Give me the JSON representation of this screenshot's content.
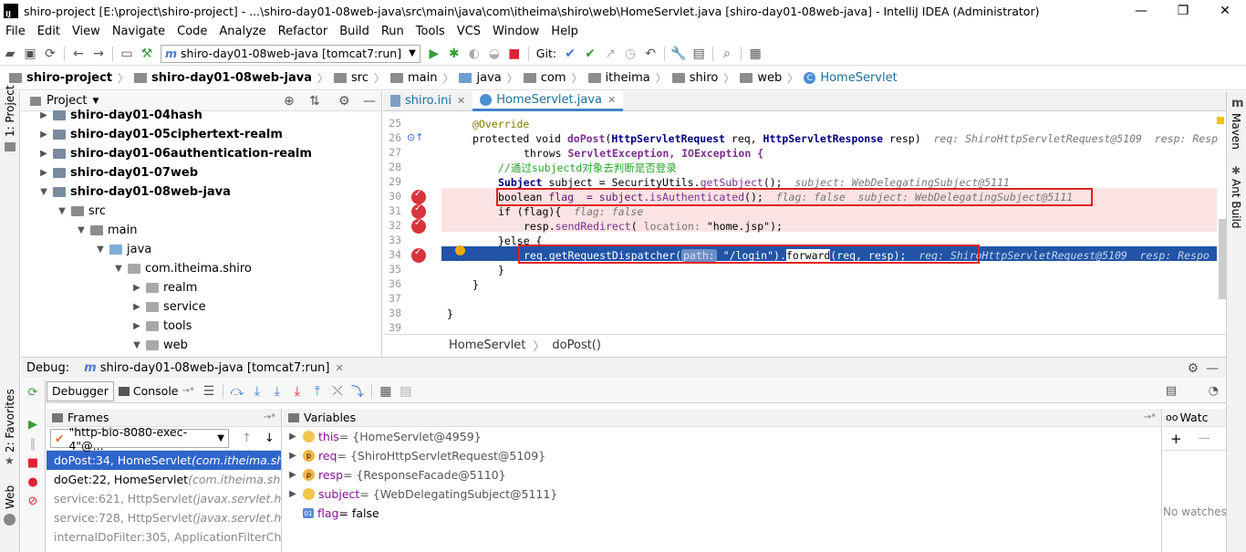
{
  "window": {
    "title": "shiro-project [E:\\project\\shiro-project] - ...\\shiro-day01-08web-java\\src\\main\\java\\com\\itheima\\shiro\\web\\HomeServlet.java [shiro-day01-08web-java] - IntelliJ IDEA (Administrator)",
    "logo": "IJ",
    "minimize": "—",
    "maximize": "❐",
    "close": "✕"
  },
  "menu": [
    "File",
    "Edit",
    "View",
    "Navigate",
    "Code",
    "Analyze",
    "Refactor",
    "Build",
    "Run",
    "Tools",
    "VCS",
    "Window",
    "Help"
  ],
  "toolbar": {
    "run_config": "shiro-day01-08web-java [tomcat7:run]",
    "run_config_icon": "m",
    "git_label": "Git:"
  },
  "breadcrumbs": [
    {
      "label": "shiro-project",
      "bold": true,
      "icon": "folder"
    },
    {
      "label": "shiro-day01-08web-java",
      "bold": true,
      "icon": "folder"
    },
    {
      "label": "src",
      "icon": "folder"
    },
    {
      "label": "main",
      "icon": "folder"
    },
    {
      "label": "java",
      "icon": "folder-blue"
    },
    {
      "label": "com",
      "icon": "folder"
    },
    {
      "label": "itheima",
      "icon": "folder"
    },
    {
      "label": "shiro",
      "icon": "folder"
    },
    {
      "label": "web",
      "icon": "folder"
    },
    {
      "label": "HomeServlet",
      "icon": "class"
    }
  ],
  "left_strip": {
    "project": "1: Project",
    "favorites": "2: Favorites",
    "web": "Web"
  },
  "right_strip": {
    "maven": "Maven",
    "ant": "Ant Build",
    "m_icon": "m"
  },
  "project_panel": {
    "title": "Project",
    "tree": [
      {
        "label": "shiro-day01-04hash",
        "indent": 1,
        "arrow": "▶",
        "bold": true,
        "type": "mod"
      },
      {
        "label": "shiro-day01-05ciphertext-realm",
        "indent": 1,
        "arrow": "▶",
        "bold": true,
        "type": "mod"
      },
      {
        "label": "shiro-day01-06authentication-realm",
        "indent": 1,
        "arrow": "▶",
        "bold": true,
        "type": "mod"
      },
      {
        "label": "shiro-day01-07web",
        "indent": 1,
        "arrow": "▶",
        "bold": true,
        "type": "mod"
      },
      {
        "label": "shiro-day01-08web-java",
        "indent": 1,
        "arrow": "▼",
        "bold": true,
        "type": "mod"
      },
      {
        "label": "src",
        "indent": 2,
        "arrow": "▼",
        "bold": false,
        "type": "fold"
      },
      {
        "label": "main",
        "indent": 3,
        "arrow": "▼",
        "bold": false,
        "type": "fold"
      },
      {
        "label": "java",
        "indent": 4,
        "arrow": "▼",
        "bold": false,
        "type": "src"
      },
      {
        "label": "com.itheima.shiro",
        "indent": 5,
        "arrow": "▼",
        "bold": false,
        "type": "pkg"
      },
      {
        "label": "realm",
        "indent": 6,
        "arrow": "▶",
        "bold": false,
        "type": "pkg"
      },
      {
        "label": "service",
        "indent": 6,
        "arrow": "▶",
        "bold": false,
        "type": "pkg"
      },
      {
        "label": "tools",
        "indent": 6,
        "arrow": "▶",
        "bold": false,
        "type": "pkg"
      },
      {
        "label": "web",
        "indent": 6,
        "arrow": "▼",
        "bold": false,
        "type": "pkg"
      }
    ]
  },
  "editor": {
    "tabs": [
      {
        "label": "shiro.ini",
        "active": false
      },
      {
        "label": "HomeServlet.java",
        "active": true
      }
    ],
    "line_numbers": [
      "25",
      "26",
      "27",
      "28",
      "29",
      "30",
      "31",
      "32",
      "33",
      "34",
      "35",
      "36",
      "37",
      "38",
      "39"
    ],
    "lines": {
      "l25_ann": "@Override",
      "l26_a": "protected void ",
      "l26_m": "doPost",
      "l26_b": "(",
      "l26_t1": "HttpServletRequest",
      "l26_c": " req, ",
      "l26_t2": "HttpServletResponse",
      "l26_d": " resp)",
      "l26_inl": "req: ShiroHttpServletRequest@5109  resp: Resp",
      "l27_a": "throws ",
      "l27_b": "ServletException, IOException {",
      "l28_cmt": "//通过subjectd对象去判断是否登录",
      "l29_a": "Subject",
      "l29_b": " subject = SecurityUtils.",
      "l29_c": "getSubject",
      "l29_d": "();",
      "l29_inl": "subject: WebDelegatingSubject@5111",
      "l30_a": "boolean",
      "l30_b": " flag  = subject.",
      "l30_c": "isAuthenticated",
      "l30_d": "();",
      "l30_inl": "flag: false  subject: WebDelegatingSubject@5111",
      "l31_a": "if",
      "l31_b": " (flag){",
      "l31_inl": "flag: false",
      "l32_a": "resp.",
      "l32_b": "sendRedirect",
      "l32_c": "( ",
      "l32_hint": "location:",
      "l32_str": " \"home.jsp\"",
      "l32_d": ");",
      "l33": "}else {",
      "l34_a": "req.getRequestDispatcher(",
      "l34_hint": "path:",
      "l34_str": " \"/login\"",
      "l34_b": ").",
      "l34_c": "forward",
      "l34_d": "(req, resp);",
      "l34_inl": "req: ShiroHttpServletRequest@5109  resp: Respo",
      "l35": "}",
      "l36": "}",
      "l38": "}"
    },
    "status_breadcrumb": [
      "HomeServlet",
      "doPost()"
    ]
  },
  "debug": {
    "label": "Debug:",
    "session": "shiro-day01-08web-java [tomcat7:run]",
    "tabs": [
      "Debugger",
      "Console"
    ],
    "frames_title": "Frames",
    "thread": "\"http-bio-8080-exec-4\"@...",
    "frames": [
      {
        "main": "doPost:34, HomeServlet ",
        "pkg": "(com.itheima.shiro",
        "state": "sel"
      },
      {
        "main": "doGet:22, HomeServlet ",
        "pkg": "(com.itheima.shiro.",
        "state": "normal"
      },
      {
        "main": "service:621, HttpServlet ",
        "pkg": "(javax.servlet.http)",
        "state": "dim"
      },
      {
        "main": "service:728, HttpServlet ",
        "pkg": "(javax.servlet.http)",
        "state": "dim"
      },
      {
        "main": "internalDoFilter:305, ApplicationFilterChain",
        "pkg": "",
        "state": "dim"
      }
    ],
    "variables_title": "Variables",
    "variables": [
      {
        "name": "this",
        "value": " = {HomeServlet@4959}",
        "icon": "o",
        "icon_text": ""
      },
      {
        "name": "req",
        "value": " = {ShiroHttpServletRequest@5109}",
        "icon": "p",
        "icon_text": "p"
      },
      {
        "name": "resp",
        "value": " = {ResponseFacade@5110}",
        "icon": "p",
        "icon_text": "p"
      },
      {
        "name": "subject",
        "value": " = {WebDelegatingSubject@5111}",
        "icon": "o",
        "icon_text": ""
      },
      {
        "name": "flag",
        "value": " = false",
        "icon": "b",
        "icon_text": "01"
      }
    ],
    "watches_title": "Watc",
    "no_watches": "No watches"
  },
  "colors": {
    "selection": "#2f65ca",
    "breakpoint": "#d7343b",
    "highlight_box": "#e02020",
    "execution_line": "#2154a6"
  }
}
